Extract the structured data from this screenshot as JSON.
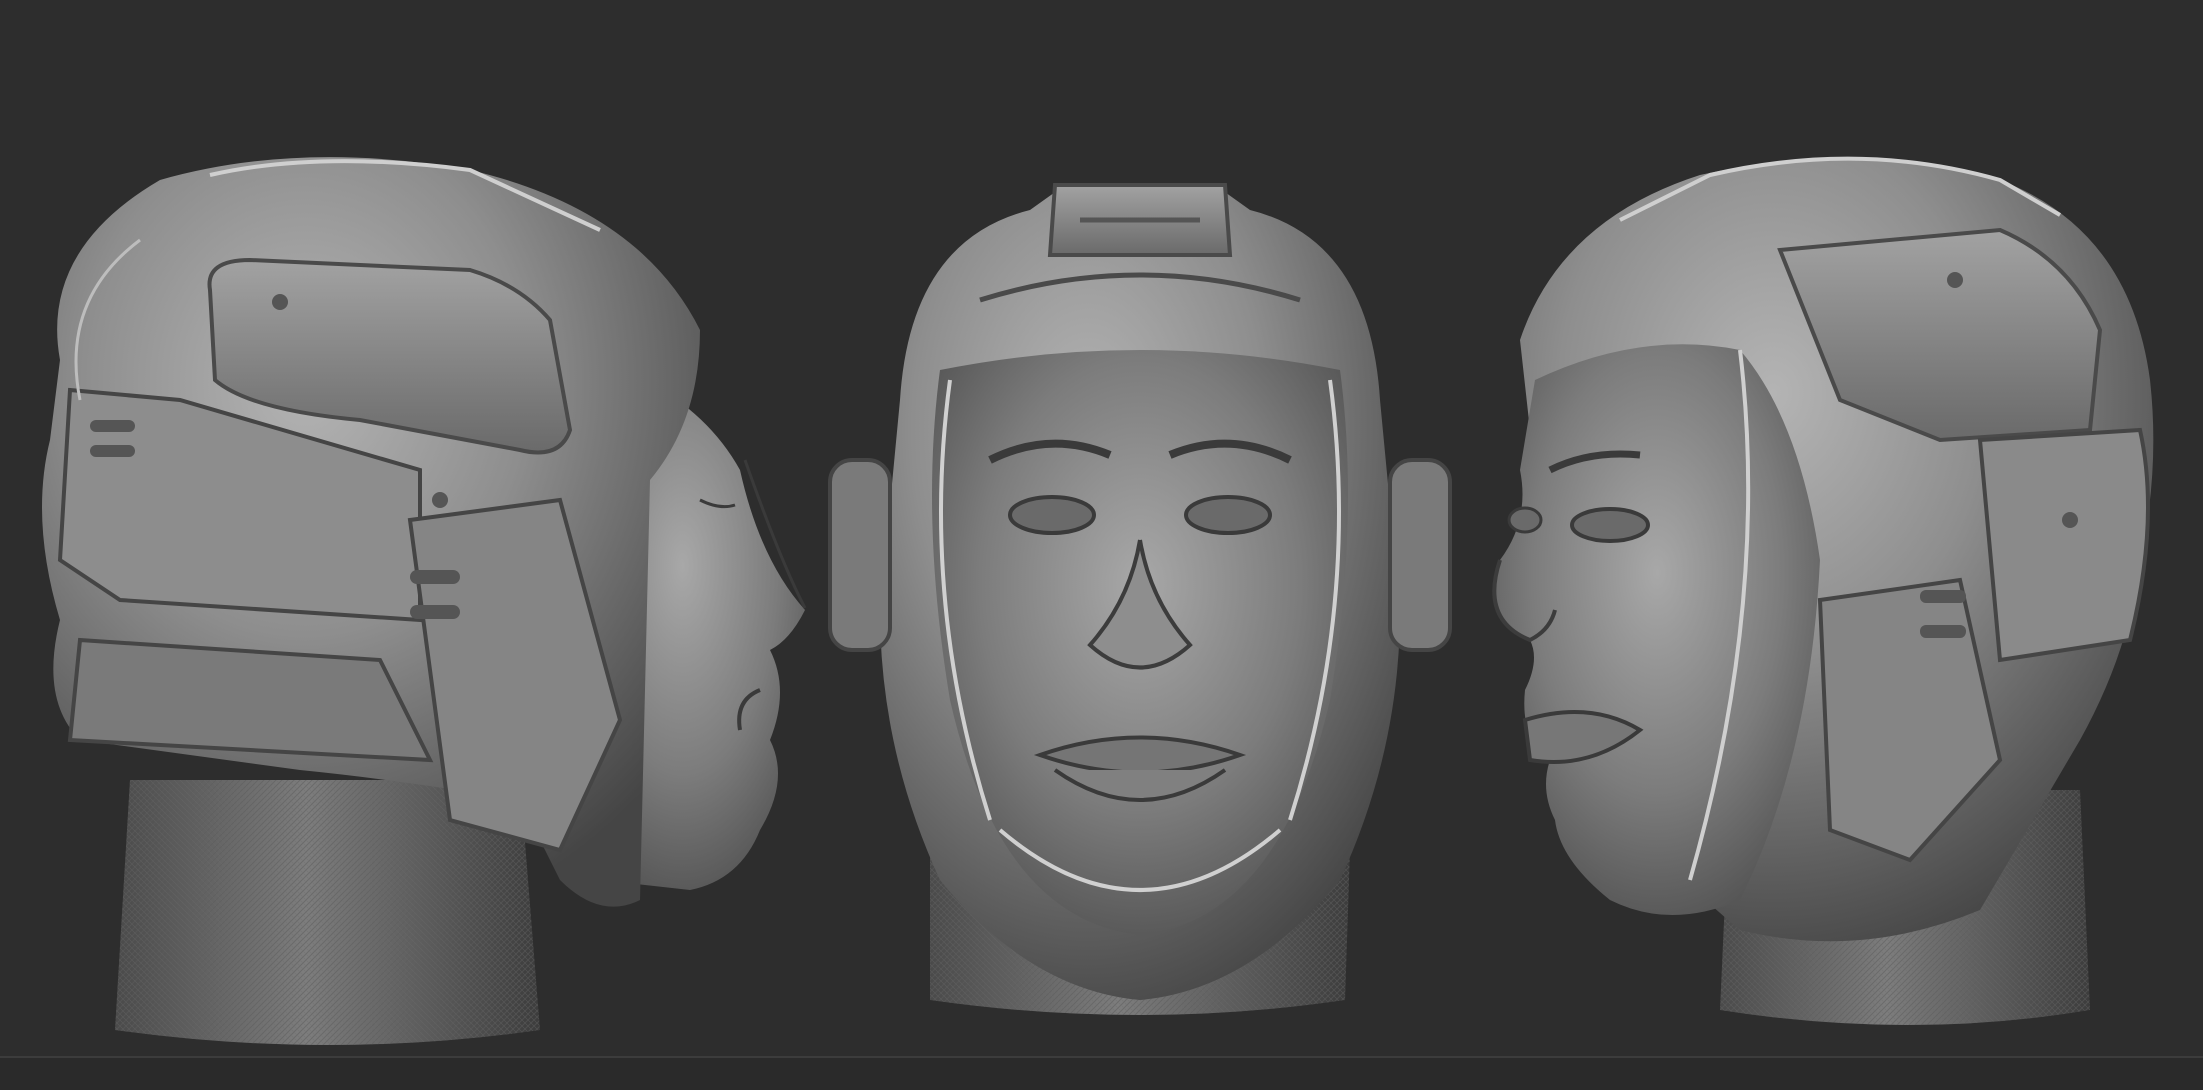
{
  "scene": {
    "background_color": "#2d2d2d",
    "material_color": "#8a8a8a",
    "views": [
      {
        "name": "left-profile"
      },
      {
        "name": "front"
      },
      {
        "name": "right-three-quarter"
      }
    ]
  }
}
